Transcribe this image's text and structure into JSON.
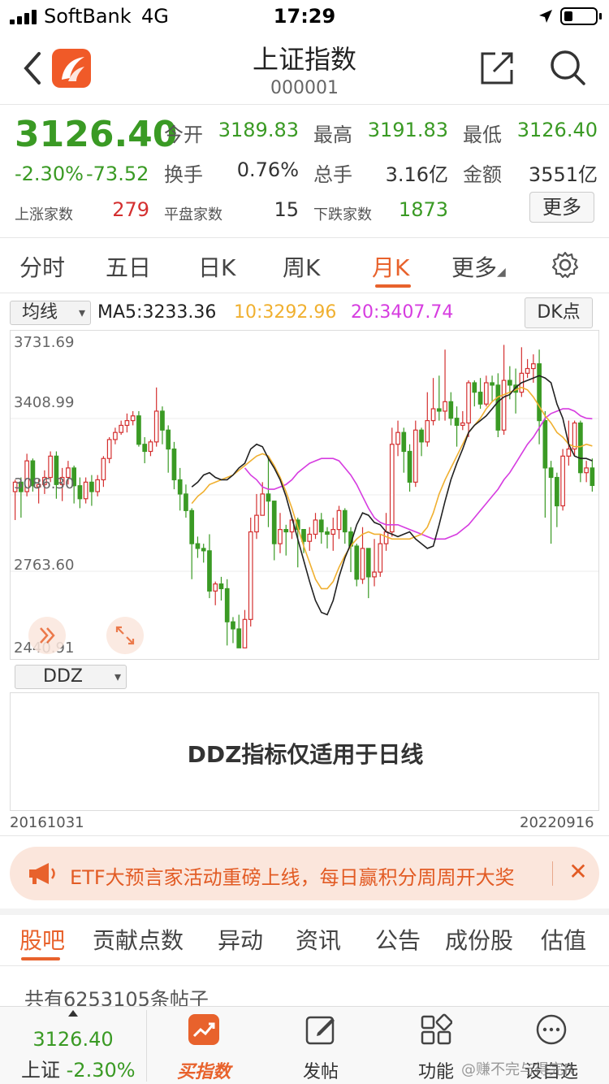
{
  "status_bar": {
    "carrier": "SoftBank",
    "network": "4G",
    "time": "17:29"
  },
  "nav": {
    "title": "上证指数",
    "code": "000001"
  },
  "quote": {
    "price": "3126.40",
    "change_pct": "-2.30%",
    "change_abs": "-73.52",
    "open_label": "今开",
    "open": "3189.83",
    "high_label": "最高",
    "high": "3191.83",
    "low_label": "最低",
    "low": "3126.40",
    "turnover_label": "换手",
    "turnover": "0.76%",
    "volume_label": "总手",
    "volume": "3.16亿",
    "amount_label": "金额",
    "amount": "3551亿",
    "up_label": "上涨家数",
    "up_count": "279",
    "flat_label": "平盘家数",
    "flat_count": "15",
    "down_label": "下跌家数",
    "down_count": "1873",
    "more_label": "更多"
  },
  "chart_tabs": [
    {
      "label": "分时"
    },
    {
      "label": "五日"
    },
    {
      "label": "日K"
    },
    {
      "label": "周K"
    },
    {
      "label": "月K",
      "active": true
    },
    {
      "label": "更多"
    }
  ],
  "ma": {
    "select": "均线",
    "ma5": "MA5:3233.36",
    "ma10": "10:3292.96",
    "ma20": "20:3407.74",
    "dk_button": "DK点"
  },
  "chart_data": {
    "type": "candlestick",
    "y_ticks": [
      "3731.69",
      "3408.99",
      "3086.30",
      "2763.60",
      "2440.91"
    ],
    "x_start": "20161031",
    "x_end": "20220916",
    "colors": {
      "up": "#d43030",
      "down": "#3a9a24",
      "ma5": "#222222",
      "ma10": "#f0b030",
      "ma20": "#d63ce0"
    },
    "candles": [
      [
        3100,
        3140,
        2980,
        3150
      ],
      [
        3140,
        3100,
        2990,
        3160
      ],
      [
        3100,
        3230,
        3080,
        3260
      ],
      [
        3230,
        3125,
        3100,
        3240
      ],
      [
        3120,
        3130,
        3050,
        3150
      ],
      [
        3130,
        3160,
        3090,
        3190
      ],
      [
        3160,
        3250,
        3140,
        3270
      ],
      [
        3250,
        3130,
        3070,
        3270
      ],
      [
        3130,
        3160,
        3060,
        3200
      ],
      [
        3160,
        3200,
        3130,
        3230
      ],
      [
        3200,
        3125,
        3050,
        3210
      ],
      [
        3125,
        3070,
        3030,
        3160
      ],
      [
        3070,
        3140,
        3050,
        3160
      ],
      [
        3140,
        3100,
        3040,
        3170
      ],
      [
        3100,
        3150,
        3080,
        3170
      ],
      [
        3150,
        3240,
        3120,
        3250
      ],
      [
        3240,
        3320,
        3220,
        3330
      ],
      [
        3320,
        3350,
        3300,
        3370
      ],
      [
        3350,
        3380,
        3340,
        3400
      ],
      [
        3380,
        3400,
        3350,
        3430
      ],
      [
        3400,
        3420,
        3380,
        3440
      ],
      [
        3420,
        3300,
        3290,
        3440
      ],
      [
        3300,
        3270,
        3220,
        3330
      ],
      [
        3270,
        3310,
        3250,
        3320
      ],
      [
        3310,
        3440,
        3290,
        3540
      ],
      [
        3440,
        3360,
        3300,
        3460
      ],
      [
        3360,
        3280,
        3180,
        3380
      ],
      [
        3280,
        3150,
        3110,
        3310
      ],
      [
        3150,
        3090,
        3020,
        3200
      ],
      [
        3090,
        3020,
        2990,
        3130
      ],
      [
        3020,
        2880,
        2730,
        3030
      ],
      [
        2880,
        2860,
        2820,
        2910
      ],
      [
        2860,
        2850,
        2800,
        2880
      ],
      [
        2850,
        2680,
        2650,
        2920
      ],
      [
        2680,
        2710,
        2620,
        2720
      ],
      [
        2710,
        2690,
        2640,
        2740
      ],
      [
        2690,
        2550,
        2450,
        2730
      ],
      [
        2550,
        2520,
        2460,
        2570
      ],
      [
        2520,
        2440,
        2440,
        2580
      ],
      [
        2440,
        2560,
        2440,
        2600
      ],
      [
        2560,
        2930,
        2530,
        2990
      ],
      [
        2930,
        3000,
        2900,
        3090
      ],
      [
        3000,
        3090,
        3000,
        3140
      ],
      [
        3090,
        3060,
        2950,
        3250
      ],
      [
        3060,
        2880,
        2810,
        3060
      ],
      [
        2880,
        2940,
        2840,
        3010
      ],
      [
        2940,
        2930,
        2830,
        2960
      ],
      [
        2930,
        2980,
        2900,
        2990
      ],
      [
        2980,
        2940,
        2780,
        2990
      ],
      [
        2940,
        2890,
        2840,
        2920
      ],
      [
        2890,
        2920,
        2850,
        2950
      ],
      [
        2920,
        2980,
        2900,
        3010
      ],
      [
        2980,
        2930,
        2880,
        3010
      ],
      [
        2930,
        2920,
        2860,
        2950
      ],
      [
        2920,
        2940,
        2850,
        2990
      ],
      [
        2940,
        3020,
        2900,
        3040
      ],
      [
        3020,
        2930,
        2880,
        3030
      ],
      [
        2930,
        2870,
        2760,
        2950
      ],
      [
        2870,
        2730,
        2700,
        2880
      ],
      [
        2730,
        2860,
        2710,
        2950
      ],
      [
        2860,
        2740,
        2650,
        2860
      ],
      [
        2740,
        2760,
        2700,
        2900
      ],
      [
        2760,
        2880,
        2740,
        2920
      ],
      [
        2880,
        2930,
        2850,
        3010
      ],
      [
        2930,
        3300,
        2910,
        3370
      ],
      [
        3300,
        3350,
        3250,
        3400
      ],
      [
        3350,
        3270,
        3180,
        3370
      ],
      [
        3270,
        3140,
        3100,
        3300
      ],
      [
        3140,
        3360,
        3120,
        3400
      ],
      [
        3360,
        3310,
        3250,
        3370
      ],
      [
        3310,
        3400,
        3290,
        3520
      ],
      [
        3400,
        3450,
        3380,
        3580
      ],
      [
        3450,
        3440,
        3400,
        3590
      ],
      [
        3440,
        3480,
        3400,
        3700
      ],
      [
        3480,
        3410,
        3380,
        3520
      ],
      [
        3410,
        3380,
        3290,
        3460
      ],
      [
        3380,
        3390,
        3360,
        3440
      ],
      [
        3390,
        3560,
        3330,
        3570
      ],
      [
        3560,
        3520,
        3460,
        3570
      ],
      [
        3520,
        3470,
        3450,
        3580
      ],
      [
        3470,
        3560,
        3460,
        3590
      ],
      [
        3560,
        3550,
        3480,
        3590
      ],
      [
        3550,
        3360,
        3330,
        3600
      ],
      [
        3360,
        3570,
        3340,
        3720
      ],
      [
        3570,
        3550,
        3490,
        3630
      ],
      [
        3550,
        3520,
        3430,
        3620
      ],
      [
        3520,
        3600,
        3500,
        3710
      ],
      [
        3600,
        3620,
        3580,
        3660
      ],
      [
        3620,
        3640,
        3560,
        3680
      ],
      [
        3640,
        3400,
        3300,
        3700
      ],
      [
        3400,
        3200,
        2990,
        3440
      ],
      [
        3200,
        3160,
        2880,
        3230
      ],
      [
        3160,
        3040,
        2950,
        3180
      ],
      [
        3040,
        3250,
        3020,
        3280
      ],
      [
        3250,
        3280,
        3210,
        3400
      ],
      [
        3280,
        3390,
        3250,
        3400
      ],
      [
        3390,
        3180,
        3140,
        3400
      ],
      [
        3180,
        3200,
        3140,
        3230
      ],
      [
        3200,
        3126,
        3100,
        3240
      ]
    ],
    "ma5": [
      3120,
      3140,
      3170,
      3180,
      3160,
      3150,
      3150,
      3170,
      3200,
      3220,
      3280,
      3300,
      3290,
      3240,
      3200,
      3150,
      3080,
      2990,
      2900,
      2810,
      2720,
      2640,
      2590,
      2580,
      2640,
      2740,
      2820,
      2880,
      2960,
      3010,
      3000,
      2970,
      2960,
      2930,
      2920,
      2910,
      2920,
      2930,
      2900,
      2880,
      2860,
      2870,
      2960,
      3060,
      3150,
      3220,
      3280,
      3350,
      3380,
      3400,
      3420,
      3450,
      3480,
      3500,
      3510,
      3540,
      3560,
      3570,
      3580,
      3590,
      3580,
      3560,
      3470,
      3410,
      3300,
      3250,
      3240,
      3240,
      3230
    ],
    "ma10": [
      3050,
      3080,
      3100,
      3130,
      3140,
      3150,
      3160,
      3170,
      3190,
      3210,
      3230,
      3250,
      3260,
      3250,
      3210,
      3160,
      3100,
      3030,
      2950,
      2870,
      2800,
      2730,
      2690,
      2690,
      2720,
      2780,
      2830,
      2870,
      2900,
      2920,
      2930,
      2920,
      2920,
      2910,
      2900,
      2900,
      2900,
      2900,
      2910,
      2920,
      2950,
      3010,
      3090,
      3150,
      3200,
      3250,
      3300,
      3350,
      3380,
      3410,
      3450,
      3480,
      3500,
      3510,
      3520,
      3530,
      3540,
      3530,
      3500,
      3460,
      3420,
      3390,
      3350,
      3330,
      3300,
      3290,
      3290,
      3300,
      3293
    ],
    "ma20": [
      3200,
      3170,
      3150,
      3120,
      3110,
      3110,
      3120,
      3130,
      3150,
      3180,
      3200,
      3220,
      3230,
      3240,
      3240,
      3240,
      3230,
      3200,
      3170,
      3130,
      3080,
      3030,
      2990,
      2970,
      2960,
      2960,
      2960,
      2950,
      2940,
      2930,
      2920,
      2910,
      2900,
      2900,
      2900,
      2910,
      2920,
      2940,
      2960,
      2990,
      3020,
      3050,
      3080,
      3110,
      3150,
      3180,
      3220,
      3260,
      3300,
      3330,
      3370,
      3410,
      3430,
      3440,
      3450,
      3450,
      3440,
      3420,
      3410,
      3408
    ]
  },
  "ddz": {
    "select": "DDZ",
    "message": "DDZ指标仅适用于日线"
  },
  "banner": {
    "text": "ETF大预言家活动重磅上线，每日赢积分周周开大奖",
    "close": "✕"
  },
  "bottom_tabs": [
    {
      "label": "股吧",
      "active": true
    },
    {
      "label": "贡献点数"
    },
    {
      "label": "异动"
    },
    {
      "label": "资讯"
    },
    {
      "label": "公告"
    },
    {
      "label": "成份股"
    },
    {
      "label": "估值"
    }
  ],
  "post_count": "共有6253105条帖子",
  "bottom_bar": {
    "price": "3126.40",
    "index_name": "上证",
    "index_pct": "-2.30%",
    "buy_label": "买指数",
    "post_label": "发帖",
    "func_label": "功能",
    "self_label": "设自选"
  },
  "watermark": "@赚不完与得完R"
}
